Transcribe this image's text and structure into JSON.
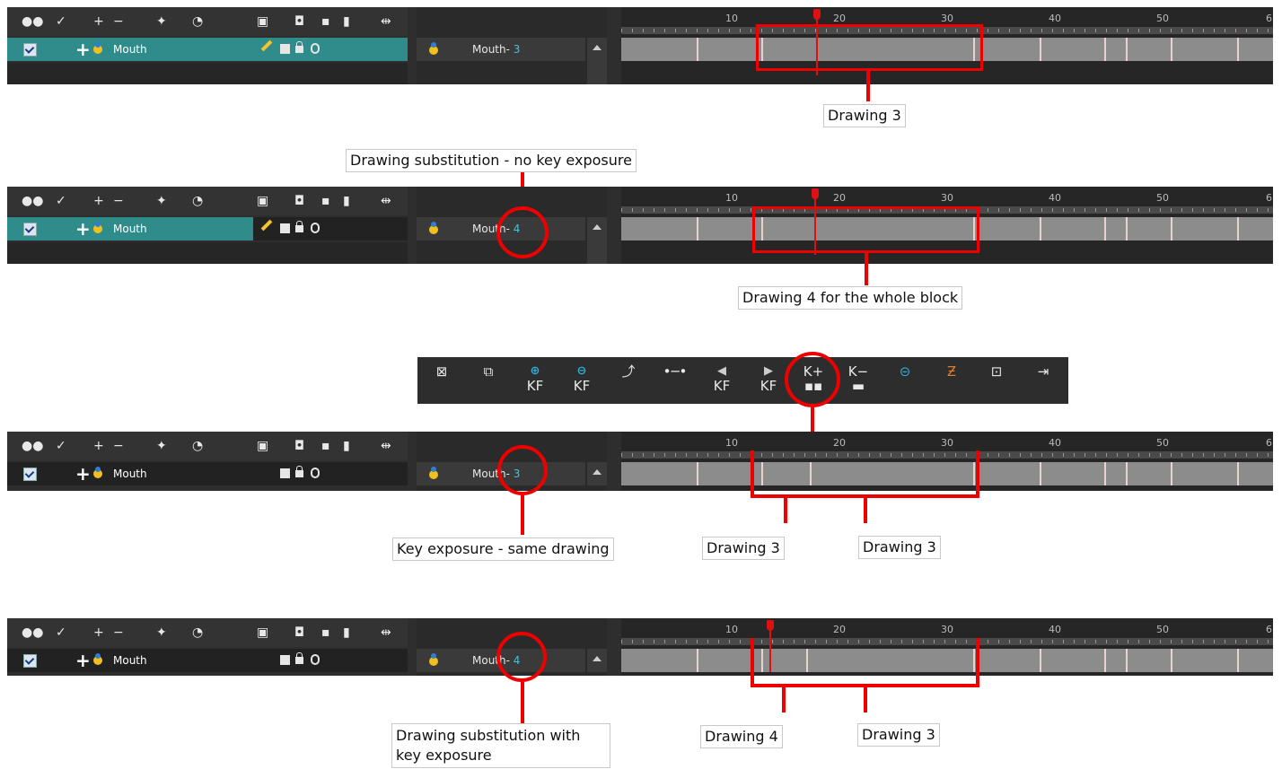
{
  "layer": {
    "name": "Mouth"
  },
  "ruler_numbers": [
    "10",
    "20",
    "30",
    "40",
    "50",
    "6"
  ],
  "panels": [
    {
      "label": "Mouth-",
      "value": "3"
    },
    {
      "label": "Mouth-",
      "value": "4"
    },
    {
      "label": "Mouth-",
      "value": "3"
    },
    {
      "label": "Mouth-",
      "value": "4"
    }
  ],
  "callouts": {
    "c1": "Drawing 3",
    "c2": "Drawing substitution - no key exposure",
    "c3": "Drawing 4 for the whole block",
    "c4": "Key exposure - same drawing",
    "c5": "Drawing 3",
    "c6": "Drawing 3",
    "c7a": "Drawing substitution with",
    "c7b": "key exposure",
    "c8": "Drawing 4",
    "c9": "Drawing 3"
  },
  "toolbar": {
    "kf": "KF",
    "k_plus": "K+",
    "k_minus": "K−"
  },
  "colors": {
    "accent_red": "#e00000",
    "layer_teal": "#2f8c8a",
    "drawing_value": "#3ec6e0"
  }
}
